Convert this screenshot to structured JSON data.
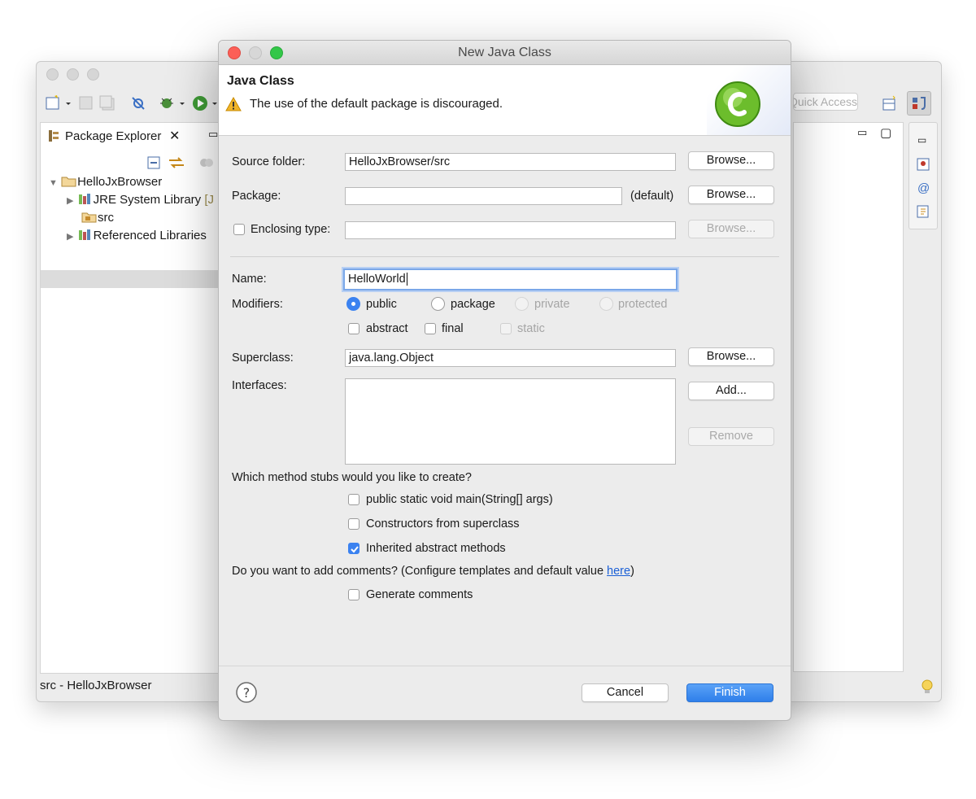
{
  "ide": {
    "package_explorer_tab": "Package Explorer",
    "quick_access_placeholder": "Quick Access",
    "tree": [
      {
        "label": "HelloJxBrowser",
        "icon": "project-folder-icon"
      },
      {
        "label": "JRE System Library",
        "suffix": "[J",
        "icon": "library-icon"
      },
      {
        "label": "src",
        "icon": "package-folder-icon"
      },
      {
        "label": "Referenced Libraries",
        "icon": "library-icon"
      }
    ],
    "status_text": "src - HelloJxBrowser"
  },
  "dialog": {
    "title": "New Java Class",
    "header_title": "Java Class",
    "header_message": "The use of the default package is discouraged.",
    "source_folder": {
      "label": "Source folder:",
      "value": "HelloJxBrowser/src",
      "button": "Browse..."
    },
    "package": {
      "label": "Package:",
      "value": "",
      "default_note": "(default)",
      "button": "Browse..."
    },
    "enclosing_type": {
      "label": "Enclosing type:",
      "value": "",
      "button": "Browse..."
    },
    "name": {
      "label": "Name:",
      "value": "HelloWorld"
    },
    "modifiers": {
      "label": "Modifiers:",
      "access": [
        "public",
        "package",
        "private",
        "protected"
      ],
      "other": [
        "abstract",
        "final",
        "static"
      ]
    },
    "superclass": {
      "label": "Superclass:",
      "value": "java.lang.Object",
      "button": "Browse..."
    },
    "interfaces": {
      "label": "Interfaces:",
      "add_button": "Add...",
      "remove_button": "Remove"
    },
    "stubs_question": "Which method stubs would you like to create?",
    "stubs": [
      "public static void main(String[] args)",
      "Constructors from superclass",
      "Inherited abstract methods"
    ],
    "comments_question": "Do you want to add comments? (Configure templates and default value ",
    "comments_link": "here",
    "comments_close": ")",
    "generate_comments": "Generate comments",
    "cancel": "Cancel",
    "finish": "Finish"
  },
  "colors": {
    "accent": "#3b82f0",
    "link": "#1a5fd6",
    "finish_button": "#3e8df2"
  }
}
